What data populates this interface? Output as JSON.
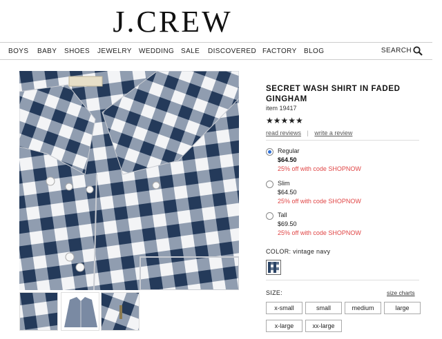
{
  "brand": {
    "logo": "J.CREW"
  },
  "nav": {
    "items": [
      "BOYS",
      "BABY",
      "SHOES",
      "JEWELRY",
      "WEDDING",
      "SALE",
      "DISCOVERED",
      "FACTORY",
      "BLOG"
    ],
    "search_label": "SEARCH",
    "search_icon": "magnifier-icon"
  },
  "product": {
    "title": "SECRET WASH SHIRT IN FADED GINGHAM",
    "item_number": "item 19417",
    "rating": {
      "stars_text": "★★★★★",
      "value": 4.5,
      "max": 5
    },
    "read_reviews": "read reviews",
    "separator": "|",
    "write_review": "write a review",
    "fits": [
      {
        "label": "Regular",
        "price": "$64.50",
        "promo": "25% off with code SHOPNOW",
        "selected": true
      },
      {
        "label": "Slim",
        "price": "$64.50",
        "promo": "25% off with code SHOPNOW",
        "selected": false
      },
      {
        "label": "Tall",
        "price": "$69.50",
        "promo": "25% off with code SHOPNOW",
        "selected": false
      }
    ],
    "color_label": "COLOR: vintage navy",
    "size_label": "SIZE:",
    "size_charts": "size charts",
    "sizes": [
      "x-small",
      "small",
      "medium",
      "large",
      "x-large",
      "xx-large"
    ]
  },
  "colors": {
    "navy": "#2b4466",
    "promo_red": "#e04545",
    "radio_blue": "#2e6fd6"
  }
}
